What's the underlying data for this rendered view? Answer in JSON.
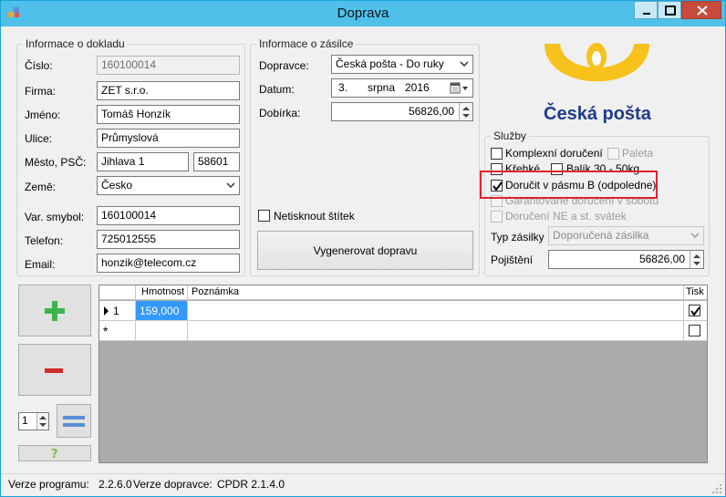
{
  "window": {
    "title": "Doprava"
  },
  "doklad": {
    "legend": "Informace o dokladu",
    "cislo_label": "Číslo:",
    "cislo": "160100014",
    "firma_label": "Firma:",
    "firma": "ZET s.r.o.",
    "jmeno_label": "Jméno:",
    "jmeno": "Tomáš Honzík",
    "ulice_label": "Ulice:",
    "ulice": "Průmyslová",
    "mesto_label": "Město, PSČ:",
    "mesto": "Jihlava 1",
    "psc": "58601",
    "zeme_label": "Země:",
    "zeme": "Česko",
    "var_label": "Var. smybol:",
    "var": "160100014",
    "telefon_label": "Telefon:",
    "telefon": "725012555",
    "email_label": "Email:",
    "email": "honzik@telecom.cz"
  },
  "zasilka": {
    "legend": "Informace o zásilce",
    "dopravce_label": "Dopravce:",
    "dopravce": "Česká pošta - Do ruky",
    "datum_label": "Datum:",
    "datum_day": "3.",
    "datum_month": "srpna",
    "datum_year": "2016",
    "dobirka_label": "Dobírka:",
    "dobirka": "56826,00",
    "netisknout_label": "Netisknout štítek",
    "generate_label": "Vygenerovat dopravu"
  },
  "logo": {
    "text": "Česká pošta"
  },
  "sluzby": {
    "legend": "Služby",
    "komplexni": "Komplexní doručení",
    "paleta": "Paleta",
    "krehke": "Křehké",
    "balik": "Balík 30 - 50kg",
    "pasmo_b": "Doručit v pásmu B (odpoledne)",
    "garantovane": "Garantované doručení v sobotu",
    "doruceni_ne": "Doručení NE a st. svátek",
    "typ_label": "Typ zásilky",
    "typ": "Doporučená zásilka",
    "pojisteni_label": "Pojištění",
    "pojisteni": "56826,00"
  },
  "grid": {
    "columns": [
      "Hmotnost",
      "Poznámka",
      "Tisk"
    ],
    "rows": [
      {
        "index": "1",
        "hmotnost": "159,000",
        "poznamka": "",
        "tisk": true
      }
    ],
    "new_row_marker": "*"
  },
  "controls": {
    "count": "1"
  },
  "status": {
    "verze_label": "Verze programu:",
    "verze": "2.2.6.0",
    "dopravce_label": "Verze dopravce:",
    "dopravce": "CPDR 2.1.4.0"
  },
  "colors": {
    "titlebar": "#4fc0ea",
    "logo_yellow": "#f7c21b",
    "logo_blue": "#1f3b8d",
    "highlight": "#e3222b",
    "plus": "#3bb54a",
    "minus": "#d42a2a"
  }
}
